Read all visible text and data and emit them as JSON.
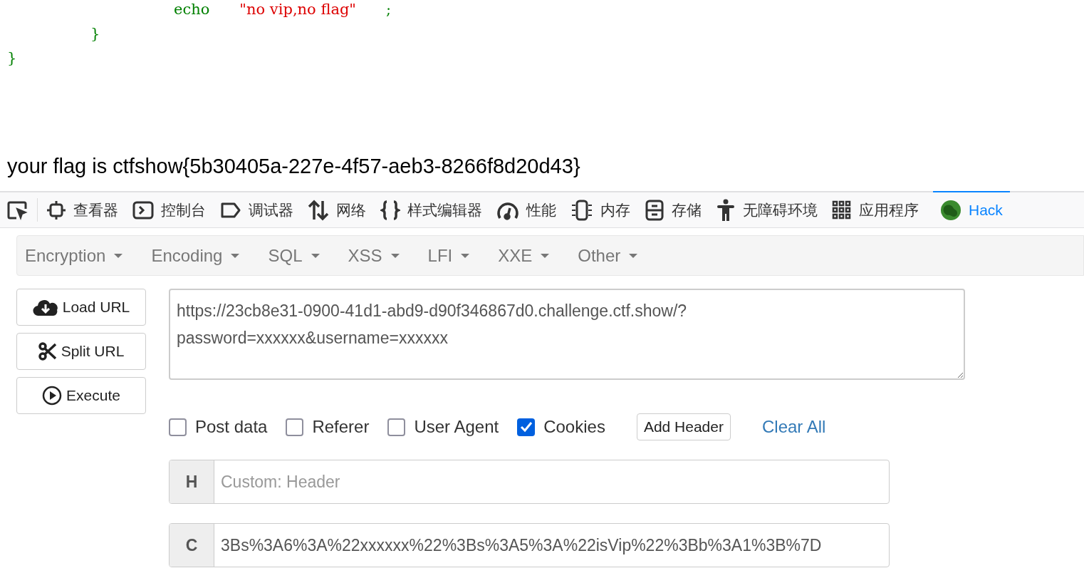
{
  "code_lines": [
    {
      "tokens": [
        {
          "text": "echo",
          "color": "#008000"
        },
        {
          "text": "\"no vip,no flag\"",
          "color": "#dd0000"
        },
        {
          "text": ";",
          "color": "#008000"
        }
      ]
    },
    {
      "tokens": [
        {
          "text": "}",
          "color": "#008000"
        }
      ]
    },
    {
      "tokens": [
        {
          "text": "}",
          "color": "#008000"
        }
      ]
    }
  ],
  "flag_message": "your flag is ctfshow{5b30405a-227e-4f57-aeb3-8266f8d20d43}",
  "devtools_tabs": [
    {
      "selected": false
    },
    {
      "label": "查看器",
      "selected": false
    },
    {
      "label": "控制台",
      "selected": false
    },
    {
      "label": "调试器",
      "selected": false
    },
    {
      "label": "网络",
      "selected": false
    },
    {
      "label": "样式编辑器",
      "selected": false
    },
    {
      "label": "性能",
      "selected": false
    },
    {
      "label": "内存",
      "selected": false
    },
    {
      "label": "存储",
      "selected": false
    },
    {
      "label": "无障碍环境",
      "selected": false
    },
    {
      "label": "应用程序",
      "selected": false
    },
    {
      "label": "Hack",
      "selected": true
    }
  ],
  "hackbar": {
    "menus": [
      "Encryption",
      "Encoding",
      "SQL",
      "XSS",
      "LFI",
      "XXE",
      "Other"
    ],
    "buttons": [
      "Load URL",
      "Split URL",
      "Execute"
    ],
    "url": "https://23cb8e31-0900-41d1-abd9-d90f346867d0.challenge.ctf.show/?\npassword=xxxxxx&username=xxxxxx",
    "options": [
      {
        "label": "Post data",
        "checked": false
      },
      {
        "label": "Referer",
        "checked": false
      },
      {
        "label": "User Agent",
        "checked": false
      },
      {
        "label": "Cookies",
        "checked": true
      }
    ],
    "add_header": "Add Header",
    "clear_all": "Clear All",
    "headers": [
      {
        "prefix": "H",
        "placeholder": "Custom: Header"
      },
      {
        "prefix": "C",
        "value": "3Bs%3A6%3A%22xxxxxx%22%3Bs%3A5%3A%22isVip%22%3Bb%3A1%3B%7D"
      }
    ]
  }
}
